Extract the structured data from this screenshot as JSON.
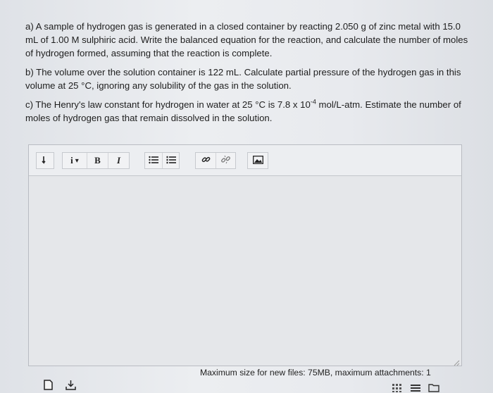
{
  "question": {
    "part_a": "a) A sample of hydrogen gas is generated in a closed container by reacting 2.050 g of zinc metal with 15.0 mL of 1.00 M sulphiric acid. Write the balanced equation for the reaction, and calculate the number of moles of hydrogen formed, assuming that the reaction is complete.",
    "part_b": "b) The volume over the solution container is 122 mL. Calculate partial pressure of the hydrogen gas in this volume at 25 °C, ignoring any solubility of the gas in the solution.",
    "part_c_before": "c) The Henry's law constant for hydrogen in water at 25 °C is 7.8 x 10",
    "part_c_exp": "-4",
    "part_c_after": " mol/L-atm. Estimate the number of moles of hydrogen gas that remain dissolved in the solution."
  },
  "toolbar": {
    "paragraph_icon": "paragraph-format-icon",
    "info_label": "i",
    "info_caret": "▾",
    "bold_label": "B",
    "italic_label": "I",
    "bullet_list_icon": "bullet-list-icon",
    "numbered_list_icon": "numbered-list-icon",
    "link_icon": "link-icon",
    "unlink_icon": "unlink-icon",
    "image_icon": "image-icon"
  },
  "footer": {
    "limits_text": "Maximum size for new files: 75MB, maximum attachments: 1"
  },
  "bottom_icons": {
    "left": [
      "file-icon",
      "download-icon"
    ],
    "right": [
      "grid-view-icon",
      "list-view-icon",
      "folder-icon"
    ]
  },
  "colors": {
    "background": "#e4e6ea",
    "border": "#b9bcc2",
    "text": "#222222"
  }
}
